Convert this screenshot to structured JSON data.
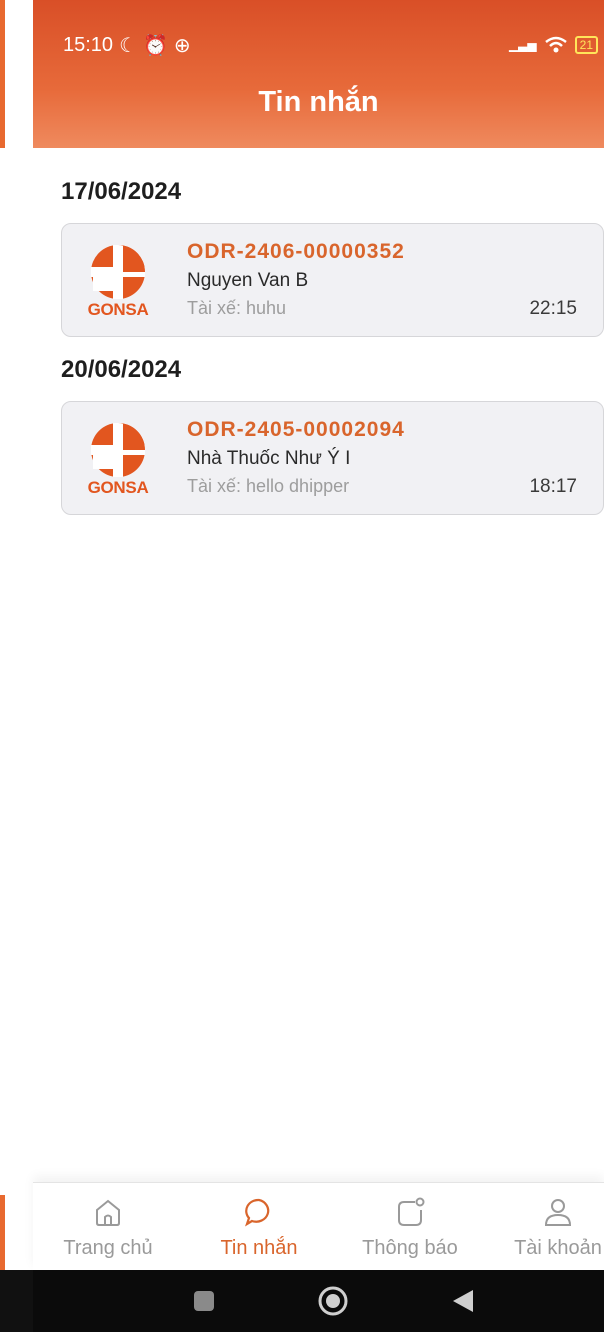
{
  "status_bar": {
    "time": "15:10",
    "battery": "21"
  },
  "header": {
    "title": "Tin nhắn"
  },
  "brand": {
    "name": "GONSA",
    "accent": "#e2561f",
    "header_color": "#e05a2c"
  },
  "groups": [
    {
      "date": "17/06/2024",
      "messages": [
        {
          "order_id": "ODR-2406-00000352",
          "customer": "Nguyen Van B",
          "driver": "Tài xế: huhu",
          "time": "22:15"
        }
      ]
    },
    {
      "date": "20/06/2024",
      "messages": [
        {
          "order_id": "ODR-2405-00002094",
          "customer": "Nhà Thuốc Như Ý I",
          "driver": "Tài xế: hello dhipper",
          "time": "18:17"
        }
      ]
    }
  ],
  "tabs": [
    {
      "label": "Trang chủ",
      "icon": "home-icon",
      "active": false
    },
    {
      "label": "Tin nhắn",
      "icon": "chat-icon",
      "active": true
    },
    {
      "label": "Thông báo",
      "icon": "notification-icon",
      "active": false
    },
    {
      "label": "Tài khoản",
      "icon": "account-icon",
      "active": false
    }
  ]
}
